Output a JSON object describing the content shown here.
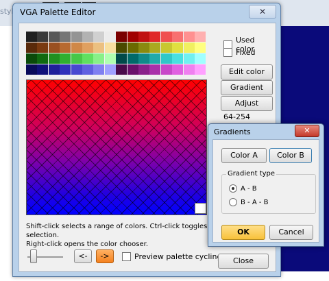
{
  "background_app": {
    "style_label": "style"
  },
  "window": {
    "title": "VGA Palette Editor",
    "close_glyph": "✕"
  },
  "palette": {
    "top_colors": [
      [
        "#202020",
        "#3a3a3a",
        "#585858",
        "#767676",
        "#949494",
        "#b2b2b2",
        "#d0d0d0",
        "#ececec",
        "#7a0000",
        "#a00000",
        "#c01010",
        "#e02828",
        "#f05050",
        "#f87070",
        "#ff9090",
        "#ffb0b0"
      ],
      [
        "#5a2a0a",
        "#7a3a10",
        "#9a5020",
        "#b86a30",
        "#d08848",
        "#e0a060",
        "#ecc080",
        "#f8e0a0",
        "#4a4a00",
        "#6a6a00",
        "#8a8a10",
        "#aaaa20",
        "#c8c830",
        "#e0e040",
        "#f0f060",
        "#ffff80"
      ],
      [
        "#0a4a0a",
        "#106a10",
        "#209020",
        "#30b030",
        "#48c848",
        "#60e060",
        "#88f088",
        "#b0ffb0",
        "#004a4a",
        "#006a6a",
        "#108a8a",
        "#20aaaa",
        "#30c8c8",
        "#48e0e0",
        "#70f0f0",
        "#a0ffff"
      ],
      [
        "#0a0a5a",
        "#10107a",
        "#20209a",
        "#3030ba",
        "#4848d0",
        "#6060e0",
        "#8080f0",
        "#a0a0ff",
        "#4a0a4a",
        "#6a106a",
        "#8a208a",
        "#aa30aa",
        "#c848c8",
        "#e060e0",
        "#f080f0",
        "#ffa0ff"
      ]
    ],
    "grid_pattern": "diagonal-cross",
    "gradient_start_color": "#ff0000",
    "gradient_end_color": "#0000ff"
  },
  "side": {
    "used_color_label": "Used color",
    "fixed_label": "Fixed",
    "edit_color_label": "Edit color",
    "gradient_label": "Gradient",
    "adjust_label": "Adjust",
    "range_text": "64-254"
  },
  "hint": {
    "line1": "Shift-click selects a range of colors. Ctrl-click toggles selection.",
    "line2": "Right-click opens the chooser."
  },
  "hint_line2_full": "Right-click opens the color chooser.",
  "footer": {
    "prev_label": "<-",
    "next_label": "->",
    "preview_label": "Preview palette cycling",
    "close_label": "Close"
  },
  "dialog": {
    "title": "Gradients",
    "close_glyph": "✕",
    "color_a_label": "Color A",
    "color_b_label": "Color B",
    "group_label": "Gradient type",
    "option_ab": "A - B",
    "option_bab": "B - A - B",
    "ok_label": "OK",
    "cancel_label": "Cancel"
  }
}
